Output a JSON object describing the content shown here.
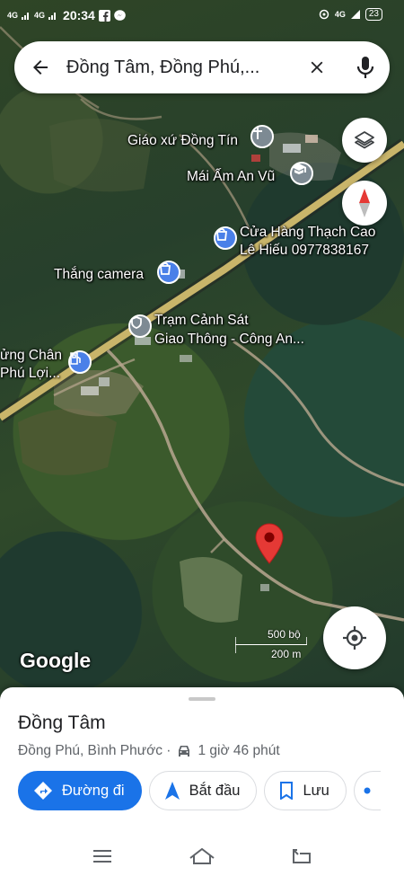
{
  "status_bar": {
    "signal_1": "4G",
    "signal_2": "4G",
    "time": "20:34",
    "network": "4G",
    "battery": "23"
  },
  "search": {
    "query": "Đồng Tâm, Đồng Phú,..."
  },
  "map": {
    "labels": {
      "church": "Giáo xứ Đồng Tín",
      "school": "Mái Ấm An Vũ",
      "shop_line1": "Cửa Hàng Thạch Cao",
      "shop_line2": "Lê Hiếu 0977838167",
      "camera": "Thắng camera",
      "police_line1": "Trạm Cảnh Sát",
      "police_line2": "Giao Thông - Công An...",
      "gas_line1": "ửng Chân",
      "gas_line2": "Phú Lợi..."
    },
    "google_logo": "Google",
    "scale_imperial": "500 bộ",
    "scale_metric": "200 m",
    "colors": {
      "pin": "#e53935",
      "road": "#c9b56a",
      "poi_blue": "#4a80e8",
      "poi_gray": "#7d8a93"
    }
  },
  "sheet": {
    "title": "Đồng Tâm",
    "subtitle": "Đồng Phú, Bình Phước ·",
    "drive_time": "1 giờ 46 phút",
    "actions": {
      "directions": "Đường đi",
      "start": "Bắt đầu",
      "save": "Lưu"
    }
  },
  "icons": [
    "back-arrow-icon",
    "close-icon",
    "mic-icon",
    "layers-icon",
    "compass-icon",
    "location-pin-icon",
    "my-location-icon",
    "car-icon",
    "directions-icon",
    "navigation-arrow-icon",
    "bookmark-icon",
    "menu-icon",
    "home-icon",
    "back-icon"
  ]
}
